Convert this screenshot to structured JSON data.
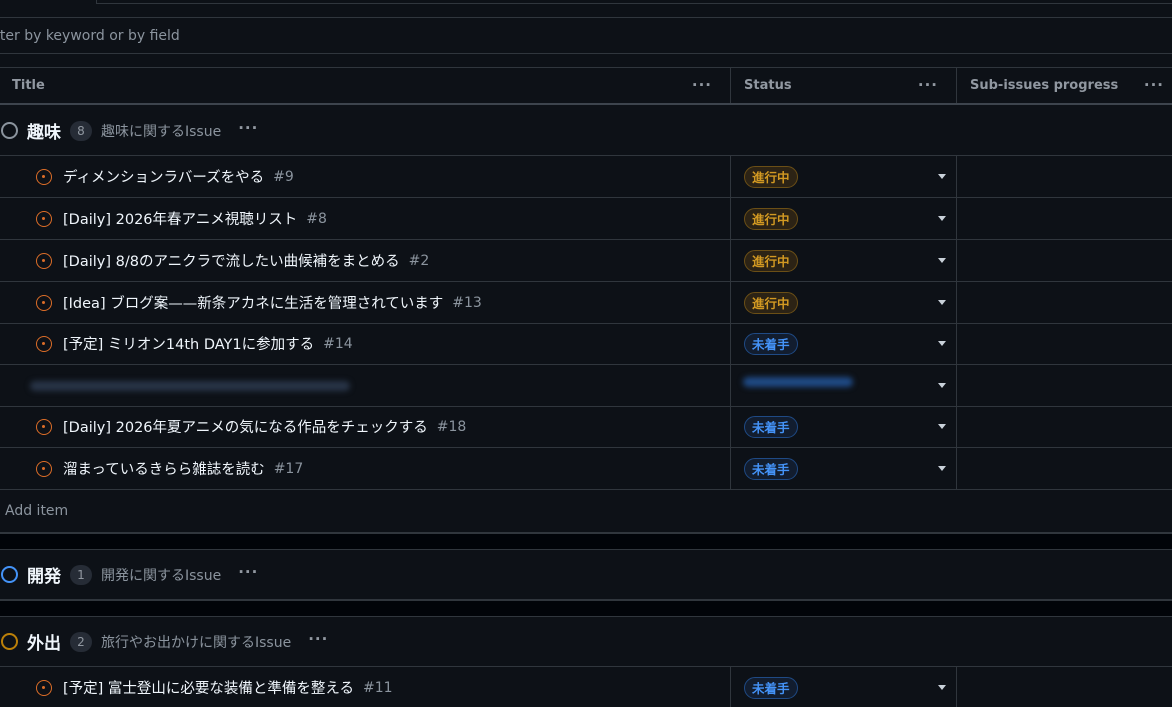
{
  "filter": {
    "placeholder": "lter by keyword or by field"
  },
  "columns": [
    {
      "label": "Title"
    },
    {
      "label": "Status"
    },
    {
      "label": "Sub-issues progress"
    }
  ],
  "more_glyph": "···",
  "groups": [
    {
      "name": "趣味",
      "count": "8",
      "description": "趣味に関するIssue",
      "ring_color": "#8b949e",
      "items": [
        {
          "title": "ディメンションラバーズをやる",
          "number": "#9",
          "status": "進行中"
        },
        {
          "title": "[Daily] 2026年春アニメ視聴リスト",
          "number": "#8",
          "status": "進行中"
        },
        {
          "title": "[Daily] 8/8のアニクラで流したい曲候補をまとめる",
          "number": "#2",
          "status": "進行中"
        },
        {
          "title": "[Idea] ブログ案——新条アカネに生活を管理されています",
          "number": "#13",
          "status": "進行中"
        },
        {
          "title": "[予定] ミリオン14th DAY1に参加する",
          "number": "#14",
          "status": "未着手"
        },
        {
          "title": "[Daily] 2026年夏アニメの気になる作品をチェックする",
          "number": "#18",
          "status": "未着手"
        },
        {
          "title": "溜まっているきらら雑誌を読む",
          "number": "#17",
          "status": "未着手"
        }
      ],
      "add_item": "Add item"
    },
    {
      "name": "開発",
      "count": "1",
      "description": "開発に関するIssue",
      "ring_color": "#4493f8"
    },
    {
      "name": "外出",
      "count": "2",
      "description": "旅行やお出かけに関するIssue",
      "ring_color": "#bb8009",
      "items": [
        {
          "title": "[予定] 富士登山に必要な装備と準備を整える",
          "number": "#11",
          "status": "未着手"
        }
      ]
    }
  ],
  "colors": {
    "in_progress": "#d29922",
    "todo": "#4493f8",
    "issue_open": "#db6d28"
  }
}
